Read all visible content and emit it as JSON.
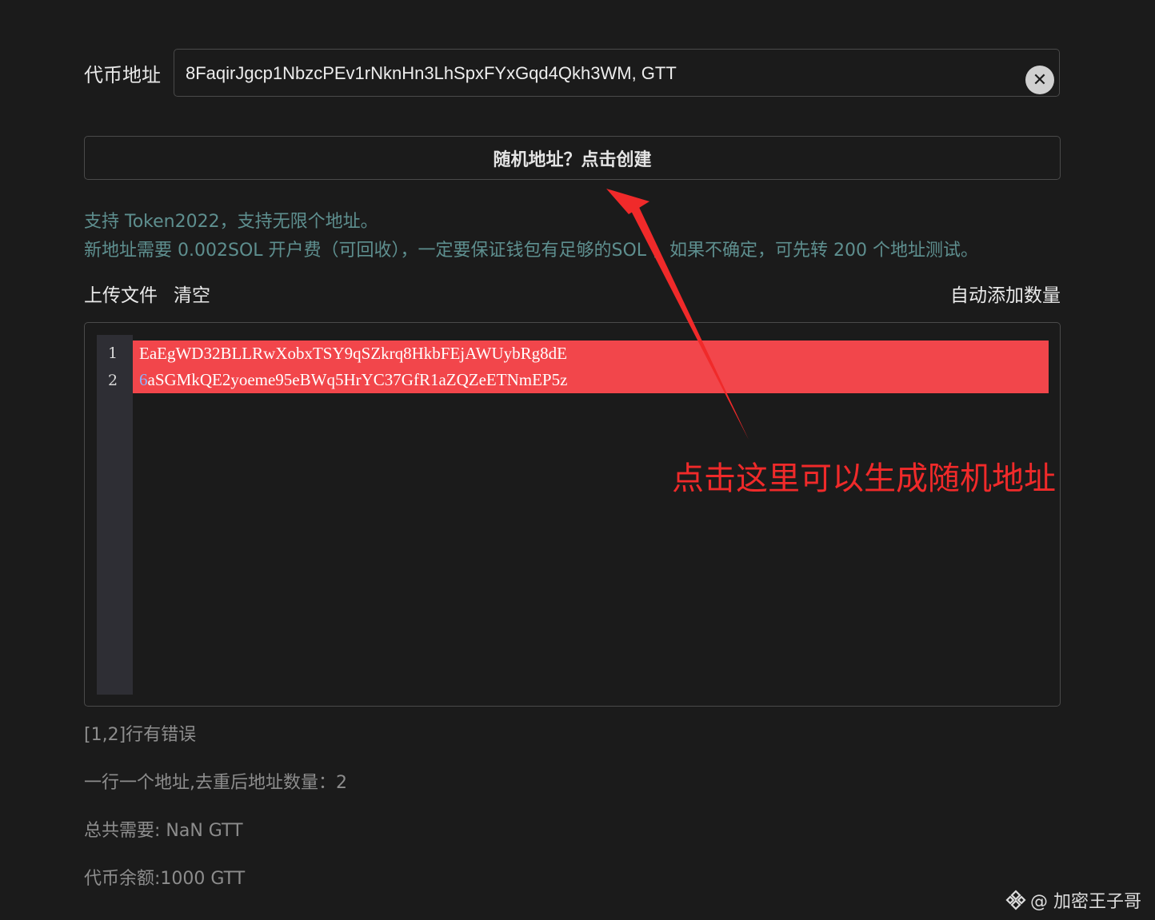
{
  "token_address": {
    "label": "代币地址",
    "value": "8FaqirJgcp1NbzcPEv1rNknHn3LhSpxFYxGqd4Qkh3WM, GTT",
    "clear_icon": "close-circle-icon"
  },
  "random_button": {
    "label": "随机地址？点击创建"
  },
  "notes": {
    "line1": "支持 Token2022，支持无限个地址。",
    "line2": "新地址需要 0.002SOL 开户费（可回收），一定要保证钱包有足够的SOL ，如果不确定，可先转 200 个地址测试。"
  },
  "toolbar": {
    "upload": "上传文件",
    "clear": "清空",
    "auto_add": "自动添加数量"
  },
  "editor": {
    "lines": [
      {
        "num": "1",
        "text": "EaEgWD32BLLRwXobxTSY9qSZkrq8HkbFEjAWUybRg8dE"
      },
      {
        "num": "2",
        "first_char": "6",
        "text": "aSGMkQE2yoeme95eBWq5HrYC37GfR1aZQZeETNmEP5z"
      }
    ],
    "error_color": "#f2464b"
  },
  "annotation": {
    "text": "点击这里可以生成随机地址",
    "color": "#f02a2a"
  },
  "status": {
    "error": "[1,2]行有错误",
    "count": "一行一个地址,去重后地址数量：2",
    "total": "总共需要: NaN GTT",
    "balance": "代币余额:1000 GTT"
  },
  "watermark": {
    "text": "@ 加密王子哥",
    "logo": "binance-logo-icon"
  }
}
